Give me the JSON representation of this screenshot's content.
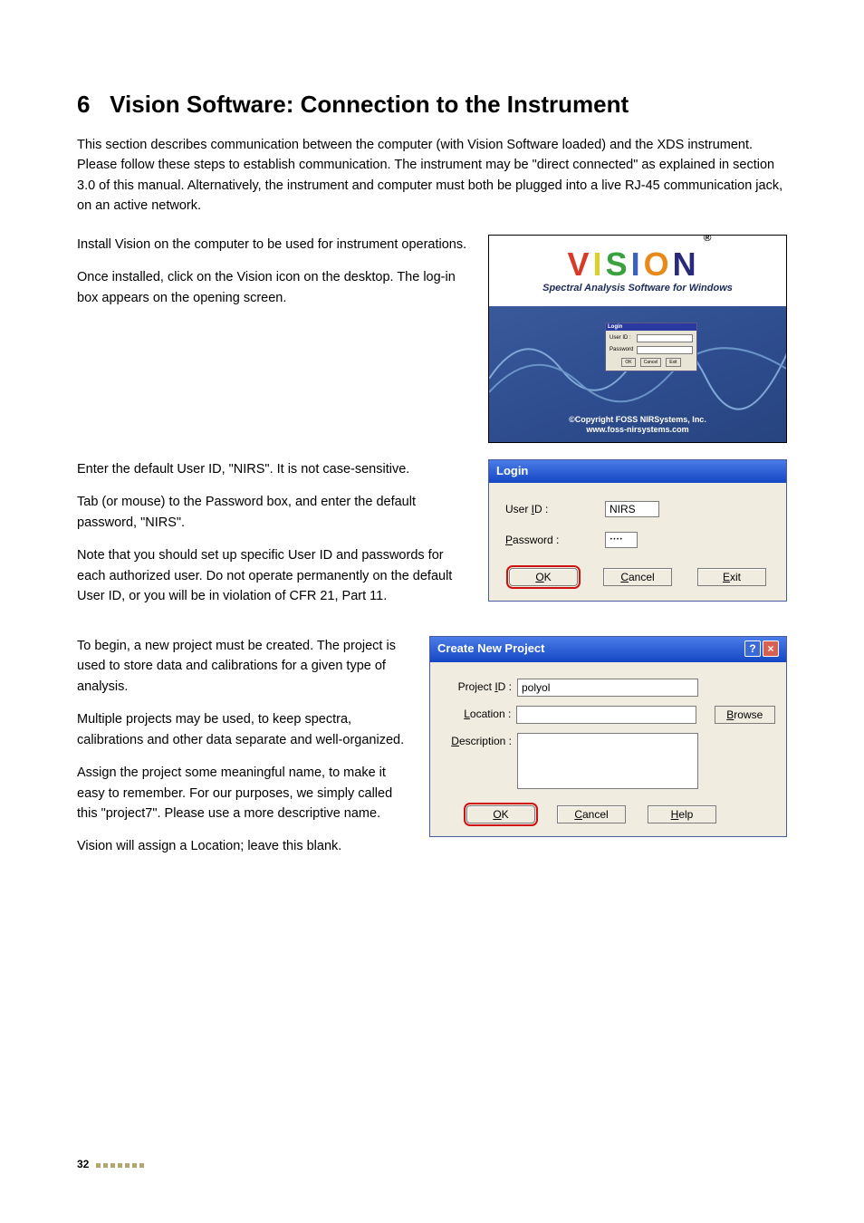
{
  "section": {
    "number": "6",
    "title": "Vision Software: Connection to the Instrument",
    "intro": "This section describes communication between the computer (with Vision Software loaded) and the XDS instrument. Please follow these steps to establish communication. The instrument may be \"direct connected\" as explained in section 3.0 of this manual. Alternatively, the instrument and computer must both be plugged into a live RJ-45 communication jack, on an active network."
  },
  "block1": {
    "p1": "Install Vision on the computer to be used for instrument operations.",
    "p2": "Once installed, click on the Vision icon on the desktop. The log-in box appears on the opening screen."
  },
  "splash": {
    "word": "VISION",
    "tagline": "Spectral Analysis Software for Windows",
    "copyright1": "©Copyright FOSS NIRSystems, Inc.",
    "copyright2": "www.foss-nirsystems.com",
    "mini": {
      "title": "Login",
      "user": "User ID :",
      "pass": "Password",
      "ok": "OK",
      "cancel": "Cancel",
      "exit": "Exit"
    }
  },
  "block2": {
    "p1": "Enter the default User ID, \"NIRS\". It is not case-sensitive.",
    "p2": "Tab (or mouse) to the Password box, and enter the default password, \"NIRS\".",
    "p3": "Note that you should set up specific User ID and passwords for each authorized user. Do not operate permanently on the default User ID, or you will be in violation of CFR 21, Part 11."
  },
  "login_dialog": {
    "title": "Login",
    "user_label": "User ID :",
    "user_value": "NIRS",
    "pass_label": "Password :",
    "pass_value": "••••",
    "ok": "OK",
    "cancel": "Cancel",
    "exit": "Exit"
  },
  "block3": {
    "p1": "To begin, a new project must be created. The project is used to store data and calibrations for a given type of analysis.",
    "p2": "Multiple projects may be used, to keep spectra, calibrations and other data separate and well-organized.",
    "p3": "Assign the project some meaningful name, to make it easy to remember. For our purposes, we simply called this \"project7\". Please use a more descriptive name.",
    "p4": "Vision will assign a Location; leave this blank."
  },
  "project_dialog": {
    "title": "Create New Project",
    "id_label": "Project ID :",
    "id_value": "polyol",
    "loc_label": "Location :",
    "loc_value": "",
    "desc_label": "Description :",
    "browse": "Browse",
    "ok": "OK",
    "cancel": "Cancel",
    "help": "Help"
  },
  "footer": {
    "page": "32"
  }
}
